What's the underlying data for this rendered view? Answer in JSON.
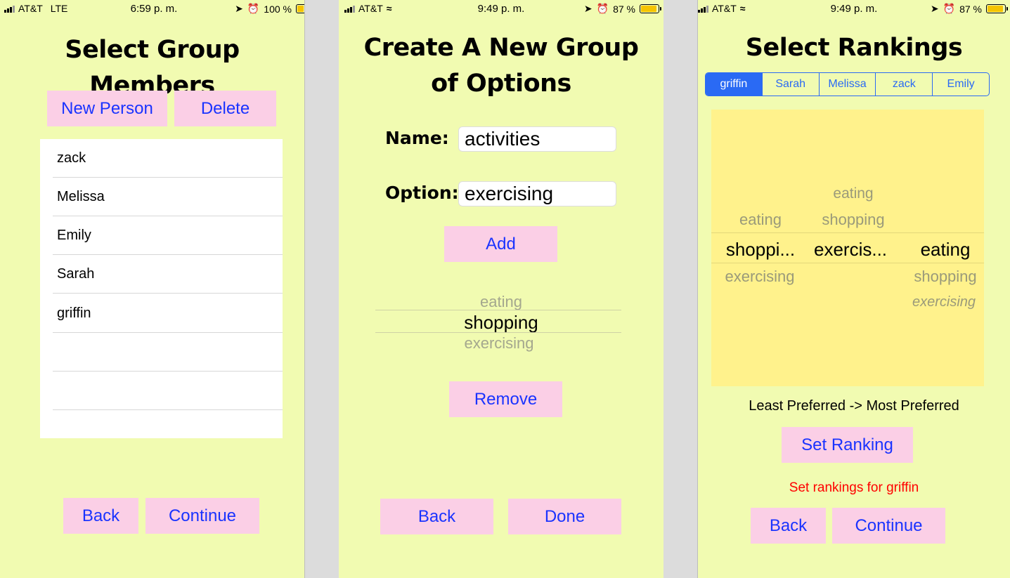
{
  "screen1": {
    "status": {
      "carrier": "AT&T",
      "network": "LTE",
      "time": "6:59 p. m.",
      "battery": "100 %",
      "battery_level": 1.0
    },
    "title": "Select Group Members",
    "new_person_label": "New Person",
    "delete_label": "Delete",
    "members": [
      "zack",
      "Melissa",
      "Emily",
      "Sarah",
      "griffin",
      "",
      "",
      ""
    ],
    "back_label": "Back",
    "continue_label": "Continue"
  },
  "screen2": {
    "status": {
      "carrier": "AT&T",
      "time": "9:49 p. m.",
      "battery": "87 %",
      "battery_level": 0.87
    },
    "title_line1": "Create A New Group",
    "title_line2": "of Options",
    "name_label": "Name:",
    "name_value": "activities",
    "option_label": "Option:",
    "option_value": "exercising",
    "add_label": "Add",
    "picker": {
      "above": "eating",
      "selected": "shopping",
      "below": "exercising"
    },
    "remove_label": "Remove",
    "back_label": "Back",
    "done_label": "Done"
  },
  "screen3": {
    "status": {
      "carrier": "AT&T",
      "time": "9:49 p. m.",
      "battery": "87 %",
      "battery_level": 0.87
    },
    "title": "Select Rankings",
    "segments": [
      "griffin",
      "Sarah",
      "Melissa",
      "zack",
      "Emily"
    ],
    "selected_segment": "griffin",
    "picker_col1": {
      "above": "eating",
      "selected": "shoppi...",
      "below": "exercising"
    },
    "picker_col2": {
      "above2": "eating",
      "above": "shopping",
      "selected": "exercis..."
    },
    "picker_col3": {
      "selected": "eating",
      "below": "shopping",
      "below2": "exercising"
    },
    "caption": "Least Preferred -> Most Preferred",
    "set_ranking_label": "Set Ranking",
    "message": "Set rankings for  griffin",
    "back_label": "Back",
    "continue_label": "Continue",
    "colors": {
      "accent": "#2a6af4",
      "message": "#ff0000",
      "button_bg": "#fbcfe6",
      "button_text": "#1a33ff",
      "background": "#f1fbb1",
      "picker_bg": "#fff28c"
    }
  }
}
